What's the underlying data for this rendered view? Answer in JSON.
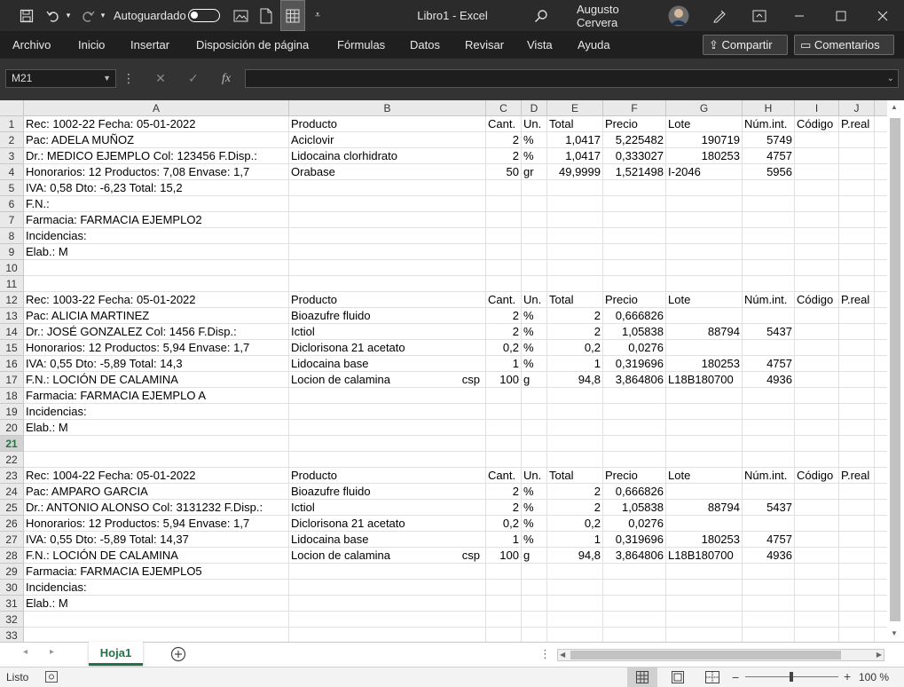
{
  "titlebar": {
    "autosave_label": "Autoguardado",
    "file_title": "Libro1  -  Excel",
    "user_name": "Augusto Cervera"
  },
  "ribbon": {
    "tabs": [
      "Archivo",
      "Inicio",
      "Insertar",
      "Disposición de página",
      "Fórmulas",
      "Datos",
      "Revisar",
      "Vista",
      "Ayuda"
    ],
    "share_label": "Compartir",
    "comments_label": "Comentarios"
  },
  "formula_bar": {
    "name_box": "M21",
    "fx": "fx",
    "formula": ""
  },
  "columns": [
    "A",
    "B",
    "C",
    "D",
    "E",
    "F",
    "G",
    "H",
    "I",
    "J"
  ],
  "rows": [
    [
      "Rec: 1002-22  Fecha: 05-01-2022",
      "Producto",
      "Cant.",
      "Un.",
      "Total",
      "Precio",
      "Lote",
      "Núm.int.",
      "Código",
      "P.real"
    ],
    [
      "Pac: ADELA MUÑOZ",
      "Aciclovir",
      "2",
      "%",
      "1,0417",
      "5,225482",
      "190719",
      "5749",
      "",
      ""
    ],
    [
      "Dr.: MEDICO EJEMPLO Col: 123456 F.Disp.:",
      "Lidocaina clorhidrato",
      "2",
      "%",
      "1,0417",
      "0,333027",
      "180253",
      "4757",
      "",
      ""
    ],
    [
      "Honorarios: 12  Productos: 7,08  Envase: 1,7",
      "Orabase",
      "50",
      "gr",
      "49,9999",
      "1,521498",
      "I-2046",
      "5956",
      "",
      ""
    ],
    [
      "IVA: 0,58  Dto: -6,23  Total: 15,2",
      "",
      "",
      "",
      "",
      "",
      "",
      "",
      "",
      ""
    ],
    [
      "F.N.:",
      "",
      "",
      "",
      "",
      "",
      "",
      "",
      "",
      ""
    ],
    [
      "Farmacia: FARMACIA EJEMPLO2",
      "",
      "",
      "",
      "",
      "",
      "",
      "",
      "",
      ""
    ],
    [
      "Incidencias:",
      "",
      "",
      "",
      "",
      "",
      "",
      "",
      "",
      ""
    ],
    [
      "Elab.: M",
      "",
      "",
      "",
      "",
      "",
      "",
      "",
      "",
      ""
    ],
    [
      "",
      "",
      "",
      "",
      "",
      "",
      "",
      "",
      "",
      ""
    ],
    [
      "",
      "",
      "",
      "",
      "",
      "",
      "",
      "",
      "",
      ""
    ],
    [
      "Rec: 1003-22  Fecha: 05-01-2022",
      "Producto",
      "Cant.",
      "Un.",
      "Total",
      "Precio",
      "Lote",
      "Núm.int.",
      "Código",
      "P.real"
    ],
    [
      "Pac: ALICIA MARTINEZ",
      "Bioazufre fluido",
      "2",
      "%",
      "2",
      "0,666826",
      "",
      "",
      "",
      ""
    ],
    [
      "Dr.: JOSÉ GONZALEZ Col: 1456 F.Disp.:",
      "Ictiol",
      "2",
      "%",
      "2",
      "1,05838",
      "88794",
      "5437",
      "",
      ""
    ],
    [
      "Honorarios: 12  Productos: 5,94  Envase: 1,7",
      "Diclorisona 21 acetato",
      "0,2",
      "%",
      "0,2",
      "0,0276",
      "",
      "",
      "",
      ""
    ],
    [
      "IVA: 0,55  Dto: -5,89  Total: 14,3",
      "Lidocaina base",
      "1",
      "%",
      "1",
      "0,319696",
      "180253",
      "4757",
      "",
      ""
    ],
    [
      "F.N.: LOCIÓN DE CALAMINA",
      "Locion de calamina|csp",
      "100",
      "g",
      "94,8",
      "3,864806",
      "L18B180700",
      "4936",
      "",
      ""
    ],
    [
      "Farmacia: FARMACIA EJEMPLO A",
      "",
      "",
      "",
      "",
      "",
      "",
      "",
      "",
      ""
    ],
    [
      "Incidencias:",
      "",
      "",
      "",
      "",
      "",
      "",
      "",
      "",
      ""
    ],
    [
      "Elab.: M",
      "",
      "",
      "",
      "",
      "",
      "",
      "",
      "",
      ""
    ],
    [
      "",
      "",
      "",
      "",
      "",
      "",
      "",
      "",
      "",
      ""
    ],
    [
      "",
      "",
      "",
      "",
      "",
      "",
      "",
      "",
      "",
      ""
    ],
    [
      "Rec: 1004-22  Fecha: 05-01-2022",
      "Producto",
      "Cant.",
      "Un.",
      "Total",
      "Precio",
      "Lote",
      "Núm.int.",
      "Código",
      "P.real"
    ],
    [
      "Pac: AMPARO GARCIA",
      "Bioazufre fluido",
      "2",
      "%",
      "2",
      "0,666826",
      "",
      "",
      "",
      ""
    ],
    [
      "Dr.: ANTONIO ALONSO Col: 3131232 F.Disp.:",
      "Ictiol",
      "2",
      "%",
      "2",
      "1,05838",
      "88794",
      "5437",
      "",
      ""
    ],
    [
      "Honorarios: 12  Productos: 5,94  Envase: 1,7",
      "Diclorisona 21 acetato",
      "0,2",
      "%",
      "0,2",
      "0,0276",
      "",
      "",
      "",
      ""
    ],
    [
      "IVA: 0,55  Dto: -5,89  Total: 14,37",
      "Lidocaina base",
      "1",
      "%",
      "1",
      "0,319696",
      "180253",
      "4757",
      "",
      ""
    ],
    [
      "F.N.: LOCIÓN DE CALAMINA",
      "Locion de calamina|csp",
      "100",
      "g",
      "94,8",
      "3,864806",
      "L18B180700",
      "4936",
      "",
      ""
    ],
    [
      "Farmacia: FARMACIA EJEMPLO5",
      "",
      "",
      "",
      "",
      "",
      "",
      "",
      "",
      ""
    ],
    [
      "Incidencias:",
      "",
      "",
      "",
      "",
      "",
      "",
      "",
      "",
      ""
    ],
    [
      "Elab.: M",
      "",
      "",
      "",
      "",
      "",
      "",
      "",
      "",
      ""
    ],
    [
      "",
      "",
      "",
      "",
      "",
      "",
      "",
      "",
      "",
      ""
    ],
    [
      "",
      "",
      "",
      "",
      "",
      "",
      "",
      "",
      "",
      ""
    ]
  ],
  "sheet_tabs": [
    "Hoja1"
  ],
  "status": {
    "ready": "Listo",
    "zoom": "100 %"
  },
  "colors": {
    "titlebar": "#2b2b2b",
    "ribbon": "#1f1f1f",
    "sheet_tab_text": "#217346"
  }
}
